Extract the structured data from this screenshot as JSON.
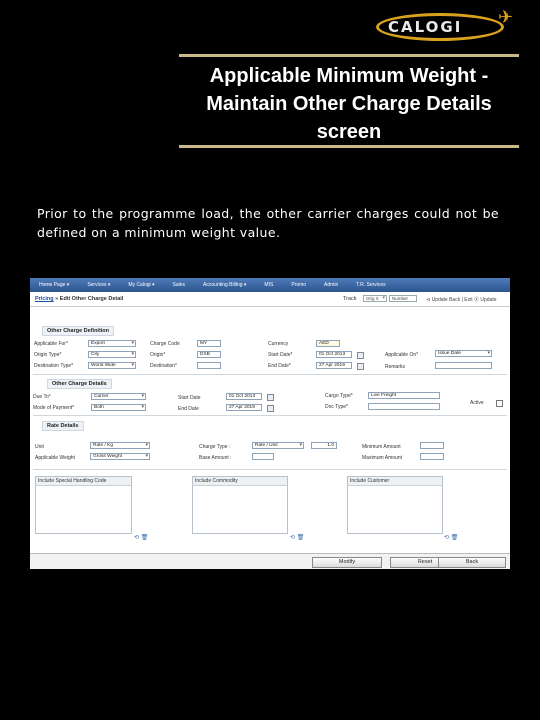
{
  "logo": {
    "text": "CALOGI"
  },
  "title_lines": [
    "Applicable Minimum Weight -",
    "Maintain Other Charge Details",
    "screen"
  ],
  "paragraph": "Prior to the programme load, the other carrier charges could not be defined on a minimum weight value.",
  "screenshot": {
    "menu": [
      "Home Page ▾",
      "Services ▾",
      "My Calogi ▾",
      "Sales",
      "Accounting Billing ▾",
      "MIS",
      "Promo",
      "Admin",
      "T.R. Services"
    ],
    "breadcrumb_link": "Pricing",
    "breadcrumb_rest": " » Edit Other Charge Detail",
    "track_label": "Track",
    "track_select": "Orig X",
    "track_number": "Number",
    "nav": "⊲ Update  Back | Exit  Ⓧ  Update",
    "sections": {
      "definition": "Other Charge Definition",
      "details": "Other Charge Details",
      "rate": "Rate Details"
    },
    "def_fields": {
      "applicable_for_label": "Applicable For*",
      "applicable_for_value": "Export",
      "origin_type_label": "Origin Type*",
      "origin_type_value": "City",
      "destination_type_label": "Destination Type*",
      "destination_type_value": "World Wide",
      "charge_code_label": "Charge Code",
      "charge_code_value": "MY",
      "origin_label": "Origin*",
      "origin_value": "DXB",
      "destination_label": "Destination*",
      "currency_label": "Currency",
      "currency_value": "AED",
      "start_date_label": "Start Date*",
      "start_date_value": "01 Oct 2013",
      "end_date_label": "End Date*",
      "end_date_value": "27 Apr 2019",
      "applicable_on_label": "Applicable On*",
      "applicable_on_value": "Issue Date",
      "remarks_label": "Remarks"
    },
    "detail_fields": {
      "due_to_label": "Due To*",
      "due_to_value": "Carrier",
      "mode_of_payment_label": "Mode of Payment*",
      "mode_of_payment_value": "Both",
      "start_date_label": "Start Date",
      "start_date_value": "01 Oct 2013",
      "end_date_label": "End Date",
      "end_date_value": "27 Apr 2019",
      "cargo_type_label": "Cargo Type*",
      "cargo_type_value": "Live Freight",
      "doc_type_label": "Doc Type*",
      "active_label": "Active"
    },
    "rate_fields": {
      "unit_label": "Unit",
      "unit_value": "Rate / Kg",
      "applicable_weight_label": "Applicable Weight",
      "applicable_weight_value": "Gross Weight",
      "charge_type_label": "Charge Type :",
      "charge_type_value": "Rate / Unit",
      "charge_value": "1.0",
      "base_amount_label": "Base Amount :",
      "min_amount_label": "Minimum Amount",
      "max_amount_label": "Maximum Amount"
    },
    "tables": {
      "special_handling": "Include Special Handling Code",
      "commodity": "Include Commodity",
      "customer": "Include Customer"
    },
    "buttons": {
      "modify": "Modify",
      "reset": "Reset",
      "back": "Back"
    }
  }
}
